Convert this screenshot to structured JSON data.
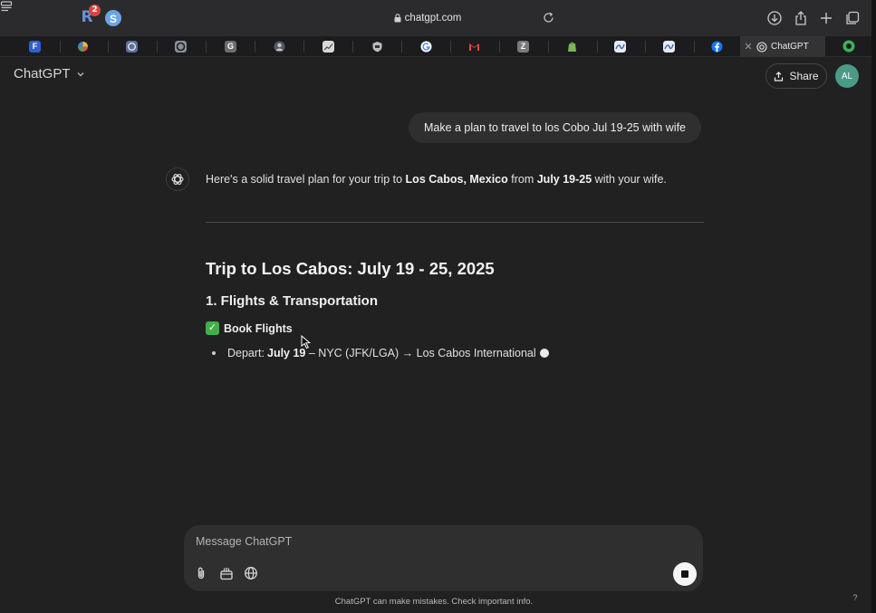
{
  "browser": {
    "extension_badge_count": "2",
    "extension_s_letter": "S",
    "extension_r_letter": "R",
    "address": "chatgpt.com",
    "active_tab_title": "ChatGPT",
    "pinned_tab_letters": [
      "F",
      "G",
      "Z"
    ]
  },
  "header": {
    "title": "ChatGPT",
    "share_label": "Share",
    "avatar_initials": "AL"
  },
  "conversation": {
    "user_message": "Make a plan to travel to los Cobo Jul 19-25 with wife",
    "intro_parts": [
      "Here's a solid travel plan for your trip to ",
      "Los Cabos, Mexico",
      " from ",
      "July 19-25",
      " with your wife."
    ],
    "heading": "Trip to Los Cabos: July 19 - 25, 2025",
    "section_heading": "1. Flights & Transportation",
    "check_icon": "✅",
    "check_item": "Book Flights",
    "bullet_prefix": "Depart: ",
    "bullet_bold": "July 19",
    "bullet_rest": " – NYC (JFK/LGA) → Los Cabos International"
  },
  "composer": {
    "placeholder": "Message ChatGPT",
    "footer_note": "ChatGPT can make mistakes. Check important info.",
    "help_label": "?"
  },
  "colors": {
    "background": "#212121",
    "bubble": "#2f2f2f",
    "avatar": "#4b9a86",
    "check": "#3fb04a"
  }
}
